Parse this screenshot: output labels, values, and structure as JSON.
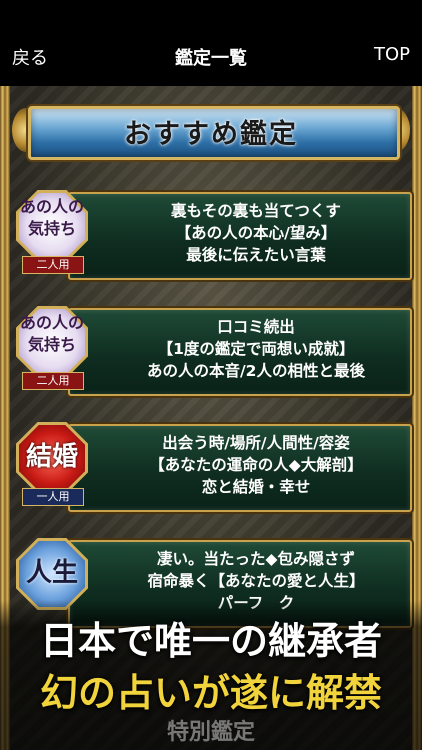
{
  "nav": {
    "back_label": "戻る",
    "title": "鑑定一覧",
    "top_label": "TOP"
  },
  "banner": {
    "title": "おすすめ鑑定"
  },
  "cards": [
    {
      "badge_text": "あの人の気持ち",
      "badge_tag": "二人用",
      "lines": [
        "裏もその裏も当てつくす",
        "【あの人の本心/望み】",
        "最後に伝えたい言葉"
      ]
    },
    {
      "badge_text": "あの人の気持ち",
      "badge_tag": "二人用",
      "lines": [
        "口コミ続出",
        "【1度の鑑定で両想い成就】",
        "あの人の本音/2人の相性と最後"
      ]
    },
    {
      "badge_text": "結婚",
      "badge_tag": "一人用",
      "lines": [
        "出会う時/場所/人間性/容姿",
        "【あなたの運命の人◆大解剖】",
        "恋と結婚・幸せ"
      ]
    },
    {
      "badge_text": "人生",
      "badge_tag": "",
      "lines": [
        "凄い。当たった◆包み隠さず",
        "宿命暴く【あなたの愛と人生】",
        "パーフ　ク"
      ]
    }
  ],
  "promo": {
    "line1": "日本で唯一の継承者",
    "line2": "幻の占いが遂に解禁",
    "under": "特別鑑定"
  },
  "colors": {
    "accent_gold": "#d6b660",
    "card_green": "#1f4a36",
    "promo_yellow": "#f1d33b"
  }
}
